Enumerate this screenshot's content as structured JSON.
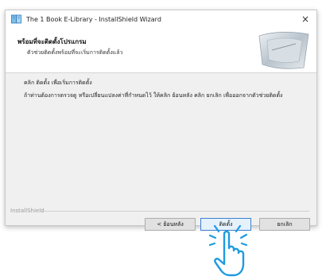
{
  "window": {
    "title": "The 1 Book E-Library - InstallShield Wizard",
    "close_glyph": "×"
  },
  "banner": {
    "heading": "พร้อมที่จะติดตั้งโปรแกรม",
    "subheading": "ตัวช่วยติดตั้งพร้อมที่จะเริ่มการติดตั้งแล้ว"
  },
  "content": {
    "line1": "คลิก ติดตั้ง เพื่อเริ่มการติดตั้ง",
    "paragraph": "ถ้าท่านต้องการตรวจดู หรือเปลี่ยนแปลงค่าที่กำหนดไว้ ให้คลิก ย้อนหลัง คลิก ยกเลิก เพื่อออกจากตัวช่วยติดตั้ง"
  },
  "footer": {
    "brand": "InstallShield"
  },
  "buttons": {
    "back": "< ย้อนหลัง",
    "install": "ติดตั้ง",
    "cancel": "ยกเลิก"
  },
  "icons": {
    "app": "app-icon",
    "close": "close-icon",
    "banner": "banner-graphic-icon",
    "hand": "hand-pointer-icon"
  },
  "colors": {
    "accent": "#1e9be0",
    "button_focus": "#3c7fd1"
  }
}
